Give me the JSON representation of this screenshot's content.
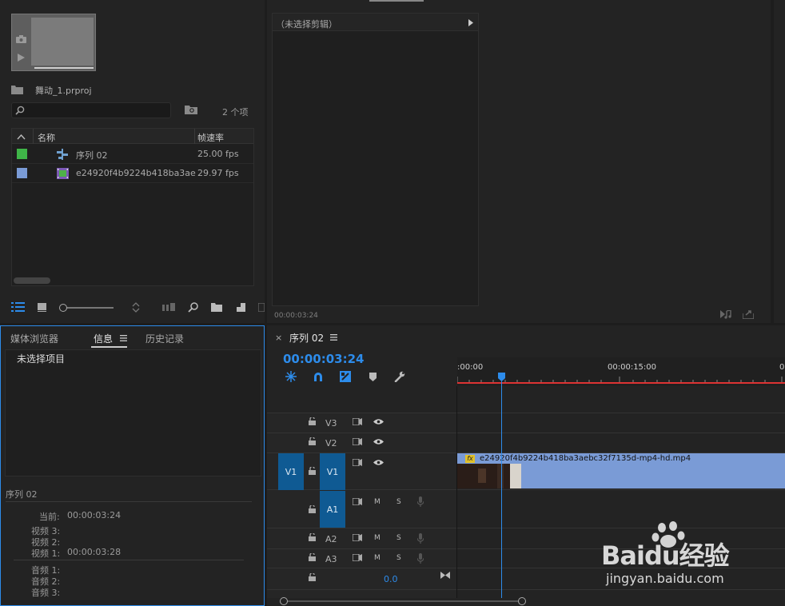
{
  "project": {
    "name": "舞动_1.prproj",
    "count": "2 个项",
    "search_placeholder": "",
    "columns": {
      "name": "名称",
      "fps": "帧速率"
    },
    "items": [
      {
        "name": "序列 02",
        "fps": "25.00 fps",
        "color": "#3fb548",
        "type": "sequence"
      },
      {
        "name": "e24920f4b9224b418ba3ae",
        "fps": "29.97 fps",
        "color": "#7a9bd6",
        "type": "clip"
      }
    ]
  },
  "source": {
    "header": "（未选择剪辑）",
    "timecode": "00:00:03:24"
  },
  "info_panel": {
    "tabs": [
      "媒体浏览器",
      "信息",
      "历史记录"
    ],
    "active_tab": "信息",
    "no_selection": "未选择项目",
    "sequence_title": "序列 02",
    "current_label": "当前:",
    "current_value": "00:00:03:24",
    "video_lines": [
      {
        "label": "视频 3:",
        "value": ""
      },
      {
        "label": "视频 2:",
        "value": ""
      },
      {
        "label": "视频 1:",
        "value": "00:00:03:28"
      }
    ],
    "audio_lines": [
      {
        "label": "音频 1:",
        "value": ""
      },
      {
        "label": "音频 2:",
        "value": ""
      },
      {
        "label": "音频 3:",
        "value": ""
      }
    ]
  },
  "timeline": {
    "tab_label": "序列 02",
    "close_glyph": "×",
    "timecode": "00:00:03:24",
    "ruler": [
      ":00:00",
      "00:00:15:00",
      "0"
    ],
    "tracks": {
      "v3": "V3",
      "v2": "V2",
      "v1": "V1",
      "src_v1": "V1",
      "a1": "A1",
      "a2": "A2",
      "a3": "A3",
      "m": "M",
      "s": "S",
      "master_value": "0.0"
    },
    "clip_name": "e24920f4b9224b418ba3aebc32f7135d-mp4-hd.mp4",
    "fx_badge": "fx",
    "playhead_fraction": 0.166
  },
  "watermark": {
    "brand": "Baidu经验",
    "url": "jingyan.baidu.com"
  },
  "colors": {
    "accent_blue": "#2d8ceb",
    "track_blue": "#0f5a93",
    "clip_blue": "#7a9bd6",
    "ruler_red": "#d33"
  }
}
